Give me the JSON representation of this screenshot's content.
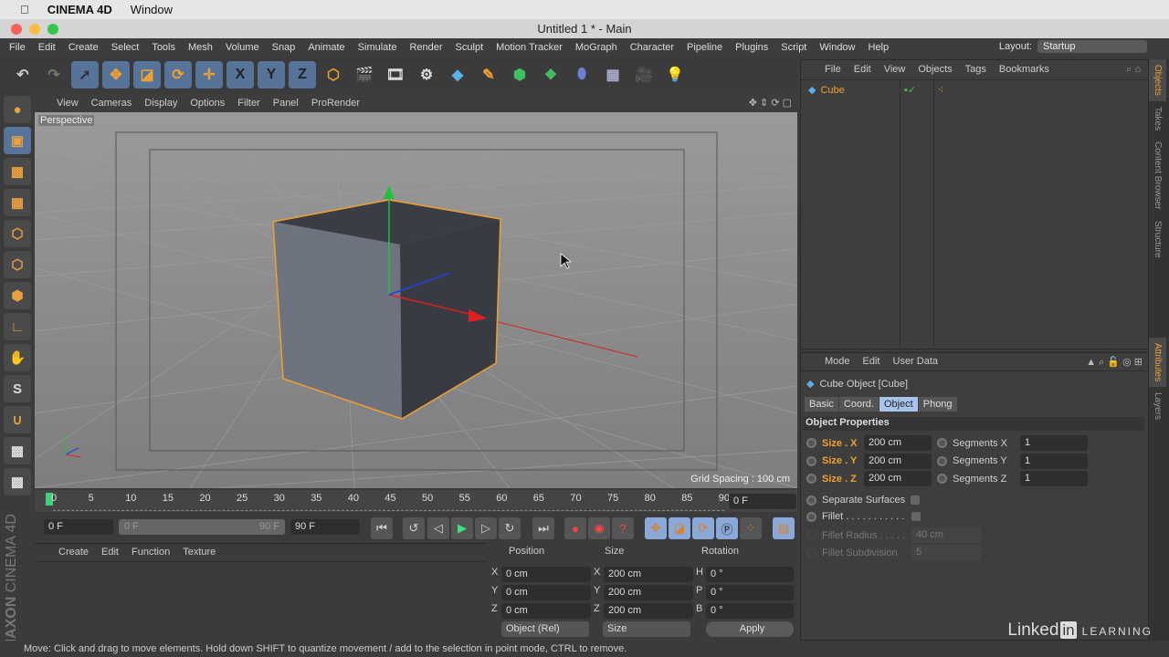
{
  "mac": {
    "app": "CINEMA 4D",
    "menu": "Window"
  },
  "window": {
    "title": "Untitled 1 * - Main"
  },
  "menubar": [
    "File",
    "Edit",
    "Create",
    "Select",
    "Tools",
    "Mesh",
    "Volume",
    "Snap",
    "Animate",
    "Simulate",
    "Render",
    "Sculpt",
    "Motion Tracker",
    "MoGraph",
    "Character",
    "Pipeline",
    "Plugins",
    "Script",
    "Window",
    "Help"
  ],
  "layout": {
    "label": "Layout:",
    "value": "Startup"
  },
  "toolbar": {
    "x": "X",
    "y": "Y",
    "z": "Z"
  },
  "viewport": {
    "menu": [
      "View",
      "Cameras",
      "Display",
      "Options",
      "Filter",
      "Panel",
      "ProRender"
    ],
    "label": "Perspective",
    "grid_spacing": "Grid Spacing : 100 cm"
  },
  "timeline": {
    "ticks": [
      "0",
      "5",
      "10",
      "15",
      "20",
      "25",
      "30",
      "35",
      "40",
      "45",
      "50",
      "55",
      "60",
      "65",
      "70",
      "75",
      "80",
      "85",
      "90"
    ],
    "current": "0 F"
  },
  "transport": {
    "start": "0 F",
    "range_start": "0 F",
    "range_end": "90 F",
    "end": "90 F"
  },
  "materials": {
    "menu": [
      "Create",
      "Edit",
      "Function",
      "Texture"
    ]
  },
  "coords": {
    "headers": [
      "Position",
      "Size",
      "Rotation"
    ],
    "rows": [
      {
        "a": "X",
        "pos": "0 cm",
        "b": "X",
        "size": "200 cm",
        "c": "H",
        "rot": "0 °"
      },
      {
        "a": "Y",
        "pos": "0 cm",
        "b": "Y",
        "size": "200 cm",
        "c": "P",
        "rot": "0 °"
      },
      {
        "a": "Z",
        "pos": "0 cm",
        "b": "Z",
        "size": "200 cm",
        "c": "B",
        "rot": "0 °"
      }
    ],
    "mode": "Object (Rel)",
    "size_mode": "Size",
    "apply": "Apply"
  },
  "status": "Move: Click and drag to move elements. Hold down SHIFT to quantize movement / add to the selection in point mode, CTRL to remove.",
  "objmgr": {
    "menu": [
      "File",
      "Edit",
      "View",
      "Objects",
      "Tags",
      "Bookmarks"
    ],
    "object": "Cube"
  },
  "attributes": {
    "menu": [
      "Mode",
      "Edit",
      "User Data"
    ],
    "title": "Cube Object [Cube]",
    "tabs": [
      "Basic",
      "Coord.",
      "Object",
      "Phong"
    ],
    "section": "Object Properties",
    "size": [
      {
        "label": "Size . X",
        "value": "200 cm"
      },
      {
        "label": "Size . Y",
        "value": "200 cm"
      },
      {
        "label": "Size . Z",
        "value": "200 cm"
      }
    ],
    "segments": [
      {
        "label": "Segments X",
        "value": "1"
      },
      {
        "label": "Segments Y",
        "value": "1"
      },
      {
        "label": "Segments Z",
        "value": "1"
      }
    ],
    "separate": "Separate Surfaces",
    "fillet": "Fillet . . . . . . . . . . .",
    "fillet_radius": "Fillet Radius . . . . .",
    "fillet_radius_value": "40 cm",
    "fillet_sub": "Fillet Subdivision",
    "fillet_sub_value": "5"
  },
  "sidetabs": {
    "top": [
      "Objects",
      "Takes",
      "Content Browser",
      "Structure"
    ],
    "bottom": [
      "Attributes",
      "Layers"
    ]
  },
  "branding": {
    "maxon": "MAXON",
    "c4d": "CINEMA 4D",
    "linkedin": "Linked",
    "in": "in",
    "learning": "LEARNING"
  }
}
